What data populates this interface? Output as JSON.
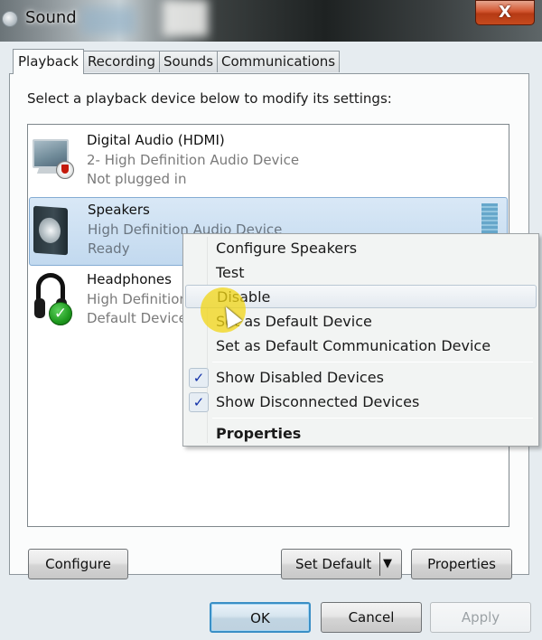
{
  "window": {
    "title": "Sound",
    "app_icon": "speaker-icon",
    "close_label": "X"
  },
  "tabs": [
    {
      "label": "Playback",
      "active": true
    },
    {
      "label": "Recording",
      "active": false
    },
    {
      "label": "Sounds",
      "active": false
    },
    {
      "label": "Communications",
      "active": false
    }
  ],
  "playback": {
    "instruction": "Select a playback device below to modify its settings:",
    "devices": [
      {
        "name": "Digital Audio (HDMI)",
        "driver": "2- High Definition Audio Device",
        "status": "Not plugged in",
        "icon": "monitor-icon",
        "badge": "unplugged-icon",
        "selected": false
      },
      {
        "name": "Speakers",
        "driver": "High Definition Audio Device",
        "status": "Ready",
        "icon": "speaker-icon",
        "badge": "",
        "selected": true
      },
      {
        "name": "Headphones",
        "driver": "High Definition Audio Device",
        "status": "Default Device",
        "icon": "headphones-icon",
        "badge": "default-check-icon",
        "selected": false
      }
    ],
    "buttons": {
      "configure": "Configure",
      "set_default": "Set Default",
      "properties": "Properties"
    }
  },
  "context_menu": {
    "items": [
      {
        "label": "Configure Speakers",
        "checked": false,
        "bold": false,
        "hover": false
      },
      {
        "label": "Test",
        "checked": false,
        "bold": false,
        "hover": false
      },
      {
        "label": "Disable",
        "checked": false,
        "bold": false,
        "hover": true
      },
      {
        "label": "Set as Default Device",
        "checked": false,
        "bold": false,
        "hover": false
      },
      {
        "label": "Set as Default Communication Device",
        "checked": false,
        "bold": false,
        "hover": false
      },
      {
        "label": "Show Disabled Devices",
        "checked": true,
        "bold": false,
        "hover": false
      },
      {
        "label": "Show Disconnected Devices",
        "checked": true,
        "bold": false,
        "hover": false
      },
      {
        "label": "Properties",
        "checked": false,
        "bold": true,
        "hover": false
      }
    ],
    "check_glyph": "✓"
  },
  "footer": {
    "ok": "OK",
    "cancel": "Cancel",
    "apply": "Apply"
  },
  "glyphs": {
    "dropdown_arrow": "▼",
    "default_check": "✓"
  },
  "colors": {
    "selection_bg": "#c8dcf0",
    "close_button": "#c9461c",
    "ok_focus": "#3a8fc6",
    "check_color": "#1030a8"
  }
}
